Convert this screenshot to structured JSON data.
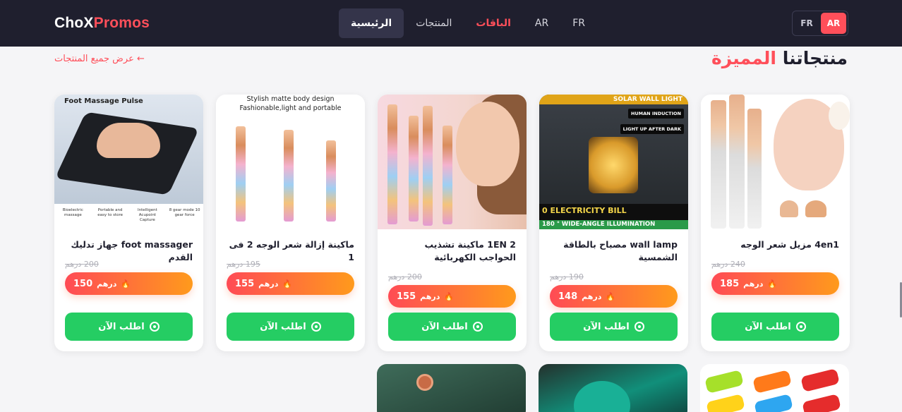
{
  "header": {
    "brand_part1": "ChoX",
    "brand_part2": "Promos",
    "nav": [
      {
        "label": "الرئيسية"
      },
      {
        "label": "المنتجات"
      },
      {
        "label": "الباقات"
      },
      {
        "label": "AR"
      },
      {
        "label": "FR"
      }
    ],
    "lang_switch": [
      {
        "label": "FR"
      },
      {
        "label": "AR"
      }
    ]
  },
  "section": {
    "title_part1": "منتجاتنا",
    "title_part2": "المميزة",
    "view_all": "← عرض جميع المنتجات"
  },
  "products": [
    {
      "name": "foot massager جهاز تدليك القدم",
      "old_price": "200 درهم",
      "price": "150",
      "currency": "درهم",
      "order_label": "اطلب الآن",
      "image_caption": "Foot Massage Pulse",
      "image_features": [
        "Bioelectric massage",
        "Portable and easy to store",
        "Intelligent Acupoint Capture",
        "8 gear mode 10 gear force"
      ]
    },
    {
      "name": "ماكينة إزالة شعر الوجه 2 فى 1",
      "old_price": "195 درهم",
      "price": "155",
      "currency": "درهم",
      "order_label": "اطلب الآن",
      "image_caption_line1": "Stylish matte body design",
      "image_caption_line2": "Fashionable,light and portable"
    },
    {
      "name": "1EN 2 ماكينة تشذيب الحواجب الكهربائية",
      "old_price": "200 درهم",
      "price": "155",
      "currency": "درهم",
      "order_label": "اطلب الآن"
    },
    {
      "name": "wall lamp مصباح بالطاقة الشمسية",
      "old_price": "190 درهم",
      "price": "148",
      "currency": "درهم",
      "order_label": "اطلب الآن",
      "image_top": "SOLAR WALL LIGHT",
      "image_badge1": "HUMAN INDUCTION",
      "image_badge2": "LIGHT UP AFTER DARK",
      "image_band1": "0 ELECTRICITY BILL",
      "image_band2": "180 ° WIDE-ANGLE ILLUMINATION"
    },
    {
      "name": "4en1 مزيل شعر الوجه",
      "old_price": "240 درهم",
      "price": "185",
      "currency": "درهم",
      "order_label": "اطلب الآن"
    }
  ],
  "colors": {
    "brand_accent": "#ff4f5a",
    "header_bg": "#1f1f2e",
    "order_green": "#25cd63",
    "price_grad_start": "#ff4b55",
    "price_grad_end": "#ff9a1c"
  },
  "icons": {
    "order": "whatsapp-icon",
    "price": "fire-icon"
  }
}
